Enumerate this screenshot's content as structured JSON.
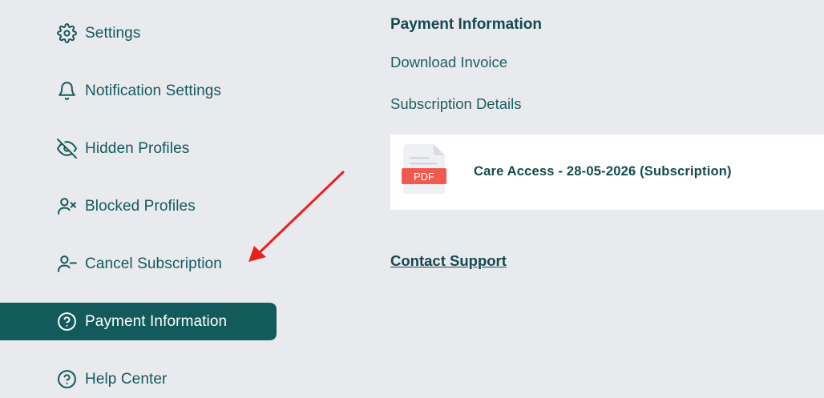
{
  "sidebar": {
    "items": [
      {
        "label": "Settings",
        "icon": "gear-icon"
      },
      {
        "label": "Notification Settings",
        "icon": "bell-icon"
      },
      {
        "label": "Hidden Profiles",
        "icon": "eye-off-icon"
      },
      {
        "label": "Blocked Profiles",
        "icon": "user-x-icon"
      },
      {
        "label": "Cancel Subscription",
        "icon": "user-minus-icon"
      },
      {
        "label": "Payment Information",
        "icon": "question-circle-icon",
        "active": true
      },
      {
        "label": "Help Center",
        "icon": "question-circle-icon"
      }
    ]
  },
  "main": {
    "title": "Payment Information",
    "download_invoice": "Download Invoice",
    "subscription_details": "Subscription Details",
    "invoice": {
      "file_badge": "PDF",
      "title": "Care Access - 28-05-2026 (Subscription)"
    },
    "contact_support": "Contact Support"
  },
  "colors": {
    "background": "#e9eaee",
    "accent": "#135a5c",
    "annotation_arrow": "#e8231f",
    "pdf_badge": "#f05a4f"
  }
}
